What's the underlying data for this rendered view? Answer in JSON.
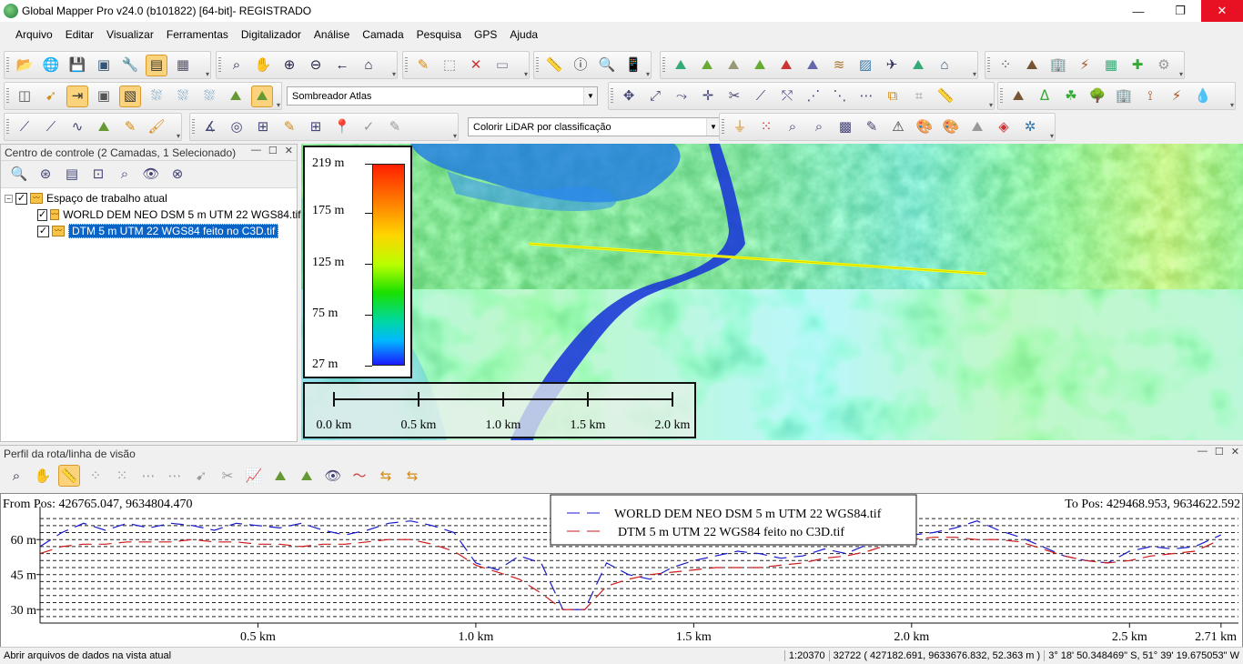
{
  "window": {
    "title": "Global Mapper Pro v24.0 (b101822) [64-bit]- REGISTRADO",
    "controls": {
      "minimize": "—",
      "restore": "❐",
      "close": "✕"
    }
  },
  "menu": [
    "Arquivo",
    "Editar",
    "Visualizar",
    "Ferramentas",
    "Digitalizador",
    "Análise",
    "Camada",
    "Pesquisa",
    "GPS",
    "Ajuda"
  ],
  "toolbars": {
    "shader_dropdown": "Sombreador Atlas",
    "lidar_dropdown": "Colorir LiDAR por classificação"
  },
  "control_center": {
    "title": "Centro de controle (2 Camadas, 1 Selecionado)",
    "workspace_label": "Espaço de trabalho atual",
    "layers": [
      {
        "name": "WORLD DEM NEO DSM 5 m UTM 22 WGS84.tif",
        "checked": true,
        "selected": false
      },
      {
        "name": "DTM 5 m UTM 22 WGS84 feito no C3D.tif",
        "checked": true,
        "selected": true
      }
    ]
  },
  "map": {
    "legend": {
      "labels": [
        "219 m",
        "175 m",
        "125 m",
        "75 m",
        "27 m"
      ],
      "min": 27,
      "max": 219
    },
    "scale_bar": {
      "labels": [
        "0.0 km",
        "0.5 km",
        "1.0 km",
        "1.5 km",
        "2.0 km"
      ]
    },
    "colors": {
      "profile_line": "#ffff00"
    }
  },
  "profile": {
    "title": "Perfil da rota/linha de visão",
    "from_pos": "From Pos: 426765.047, 9634804.470",
    "to_pos": "To Pos: 429468.953, 9634622.592",
    "chart_data": {
      "type": "line",
      "title": "",
      "xlabel": "",
      "ylabel": "",
      "xlim": [
        0,
        2.75
      ],
      "ylim": [
        25,
        71
      ],
      "y_ticks": [
        30,
        45,
        60
      ],
      "y_tick_labels": [
        "30 m",
        "45 m",
        "60 m"
      ],
      "x_ticks": [
        0.5,
        1.0,
        1.5,
        2.0,
        2.5,
        2.71
      ],
      "x_tick_labels": [
        "0.5 km",
        "1.0 km",
        "1.5 km",
        "2.0 km",
        "2.5 km",
        "2.71 km"
      ],
      "grid": true,
      "legend_position": "top-center",
      "x": [
        0,
        0.05,
        0.1,
        0.15,
        0.2,
        0.25,
        0.3,
        0.35,
        0.4,
        0.45,
        0.5,
        0.55,
        0.6,
        0.65,
        0.7,
        0.75,
        0.8,
        0.85,
        0.9,
        0.95,
        1.0,
        1.05,
        1.1,
        1.15,
        1.2,
        1.25,
        1.3,
        1.35,
        1.4,
        1.45,
        1.5,
        1.55,
        1.6,
        1.65,
        1.7,
        1.75,
        1.8,
        1.85,
        1.9,
        1.95,
        2.0,
        2.05,
        2.1,
        2.15,
        2.2,
        2.25,
        2.3,
        2.35,
        2.4,
        2.45,
        2.5,
        2.55,
        2.6,
        2.65,
        2.71
      ],
      "series": [
        {
          "name": "WORLD DEM NEO DSM 5 m UTM 22 WGS84.tif",
          "color": "#1a1acc",
          "dash": "14,8",
          "values": [
            57,
            63,
            67,
            64,
            67,
            65,
            67,
            66,
            64,
            67,
            66,
            65,
            67,
            64,
            62,
            64,
            67,
            68,
            66,
            63,
            50,
            47,
            53,
            50,
            30,
            30,
            50,
            45,
            43,
            48,
            51,
            53,
            55,
            54,
            52,
            53,
            56,
            54,
            58,
            60,
            62,
            63,
            65,
            68,
            64,
            61,
            57,
            53,
            51,
            50,
            55,
            57,
            56,
            57,
            62
          ]
        },
        {
          "name": "DTM 5 m UTM 22 WGS84 feito no C3D.tif",
          "color": "#cc1a1a",
          "dash": "14,8",
          "values": [
            54,
            57,
            58,
            58,
            59,
            59,
            59,
            60,
            59,
            59,
            58,
            58,
            57,
            58,
            58,
            59,
            60,
            60,
            58,
            55,
            49,
            46,
            43,
            37,
            30,
            30,
            40,
            43,
            45,
            46,
            47,
            48,
            48,
            48,
            49,
            50,
            52,
            53,
            55,
            58,
            60,
            61,
            61,
            60,
            60,
            59,
            56,
            53,
            51,
            50,
            51,
            53,
            54,
            55,
            60
          ]
        }
      ]
    }
  },
  "status_bar": {
    "hint": "Abrir arquivos de dados na vista atual",
    "scale": "1:20370",
    "coords": "32722 ( 427182.691, 9633676.832, 52.363 m )",
    "latlon": "3° 18' 50.348469\" S, 51° 39' 19.675053\" W"
  }
}
